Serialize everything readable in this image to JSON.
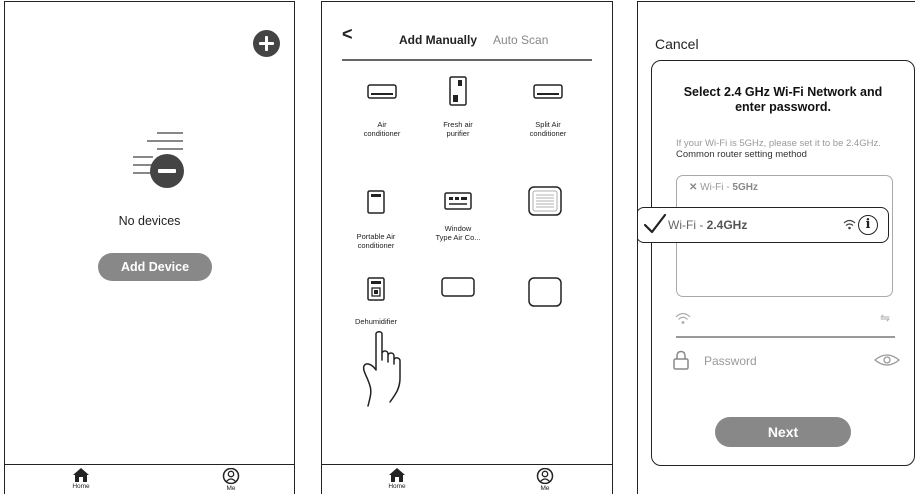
{
  "screen1": {
    "empty_text": "No devices",
    "add_button": "Add Device",
    "icons": [
      "add-circle-icon",
      "empty-list-icon"
    ]
  },
  "screen2": {
    "back": "<",
    "tab_manual": "Add Manually",
    "tab_auto": "Auto Scan",
    "devices": [
      {
        "line1": "Air",
        "line2": "conditioner",
        "icon": "air-conditioner-icon"
      },
      {
        "line1": "Fresh air",
        "line2": "purifier",
        "icon": "fresh-air-purifier-icon"
      },
      {
        "line1": "Split Air",
        "line2": "conditioner",
        "icon": "split-air-conditioner-icon"
      },
      {
        "line1": "Portable Air",
        "line2": "conditioner",
        "icon": "portable-air-conditioner-icon"
      },
      {
        "line1": "Window",
        "line2": "Type Air Co...",
        "icon": "window-air-conditioner-icon"
      },
      {
        "line1": "",
        "line2": "",
        "icon": "device-list-icon"
      },
      {
        "line1": "Dehumidifier",
        "line2": "",
        "icon": "dehumidifier-icon"
      },
      {
        "line1": "",
        "line2": "",
        "icon": "device-rect-icon"
      },
      {
        "line1": "",
        "line2": "",
        "icon": "device-square-icon"
      }
    ]
  },
  "bottom_nav": {
    "home": "Home",
    "me": "Me"
  },
  "screen3": {
    "cancel": "Cancel",
    "title_line1": "Select 2.4 GHz Wi-Fi Network and",
    "title_line2": "enter password.",
    "desc_part1": "If your Wi-Fi is 5GHz, please set it to be 2.4GHz.",
    "desc_part2": "Common router setting method",
    "wifi_5g_prefix": "Wi-Fi - ",
    "wifi_5g_band": "5GHz",
    "wifi_24g_prefix": "Wi-Fi - ",
    "wifi_24g_band": "2.4GHz",
    "info_glyph": "i",
    "password_label": "Password",
    "next": "Next",
    "swap_glyph": "⇋"
  }
}
